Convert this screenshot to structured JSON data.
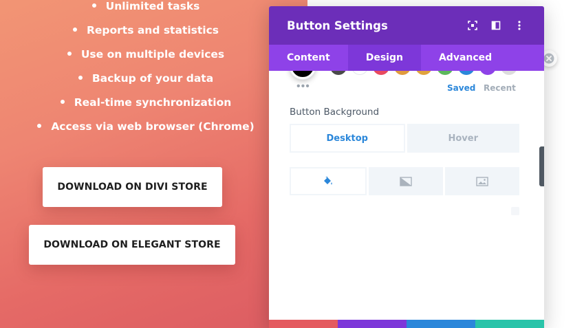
{
  "features": [
    {
      "label": "Unlimited tasks"
    },
    {
      "label": "Reports and statistics"
    },
    {
      "label": "Use on multiple devices"
    },
    {
      "label": "Backup of your data"
    },
    {
      "label": "Real-time synchronization"
    },
    {
      "label": "Access via web browser (Chrome)"
    }
  ],
  "buttons": {
    "divi_store": "DOWNLOAD ON DIVI STORE",
    "elegant_store": "DOWNLOAD ON ELEGANT STORE"
  },
  "modal": {
    "title": "Button Settings",
    "header_icons": [
      "expand-icon",
      "split-view-icon",
      "more-options-icon"
    ],
    "tabs": [
      {
        "label": "Content",
        "active": false
      },
      {
        "label": "Design",
        "active": true
      },
      {
        "label": "Advanced",
        "active": false
      }
    ],
    "palette": {
      "selected_color": "#000000",
      "swatches": [
        "#4a4a4a",
        "#ffffff",
        "#e84a5f",
        "#e09b3d",
        "#e0a33d",
        "#5cb85c",
        "#2b87da",
        "#8e42e8",
        "#dcdcdc"
      ],
      "more_icon": "ellipsis-icon",
      "saved_label": "Saved",
      "recent_label": "Recent"
    },
    "field_label": "Button Background",
    "mode_tabs": [
      {
        "label": "Desktop",
        "active": true
      },
      {
        "label": "Hover",
        "active": false
      }
    ],
    "background_tabs": [
      {
        "icon": "paint-bucket-icon",
        "active": true
      },
      {
        "icon": "gradient-icon",
        "active": false
      },
      {
        "icon": "image-icon",
        "active": false
      }
    ],
    "footer_colors": [
      "#e45a5f",
      "#7d37d9",
      "#2b87da",
      "#29c4a9"
    ]
  },
  "colors": {
    "header_bg": "#6c2eb9",
    "tabs_bg": "#8e42e8",
    "accent_blue": "#2b87da"
  }
}
